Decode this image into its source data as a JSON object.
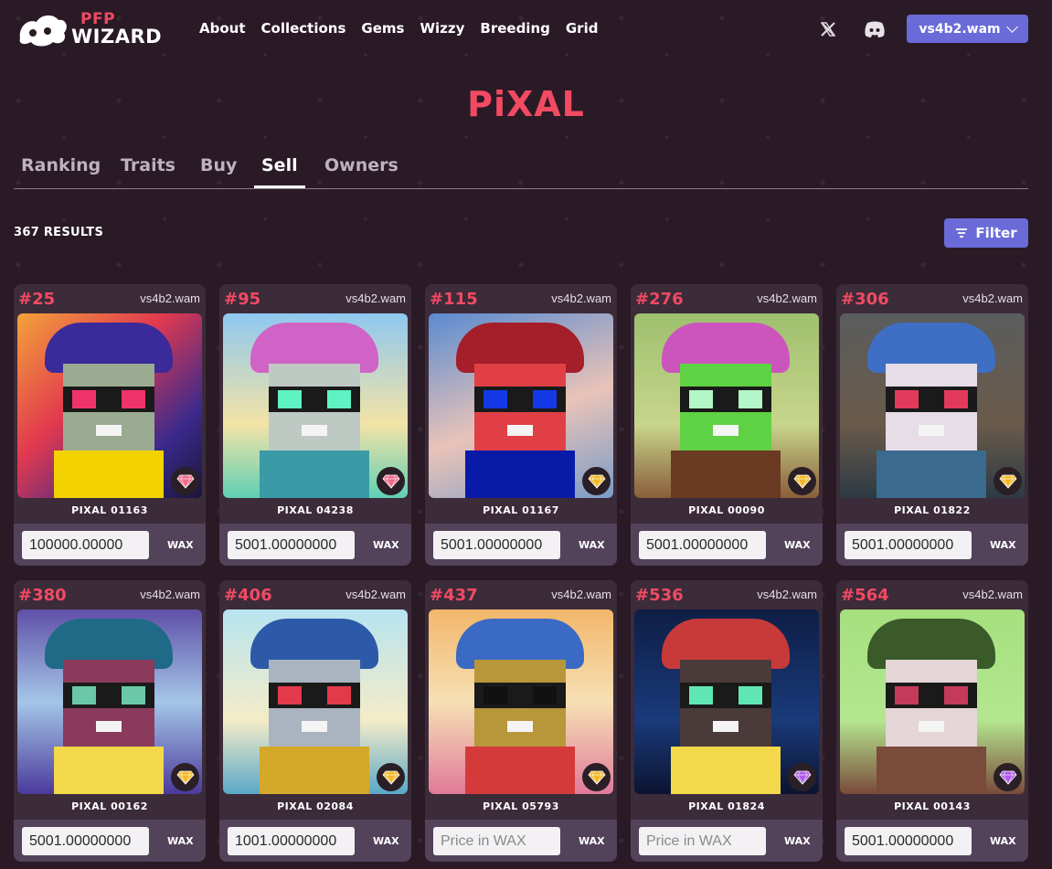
{
  "nav": {
    "logo_top": "PFP",
    "logo_bottom": "WIZARD",
    "links": [
      "About",
      "Collections",
      "Gems",
      "Wizzy",
      "Breeding",
      "Grid"
    ],
    "account": "vs4b2.wam"
  },
  "collection_title": "PiXAL",
  "tabs": [
    "Ranking",
    "Traits",
    "Buy",
    "Sell",
    "Owners"
  ],
  "active_tab": "Sell",
  "results_text": "367 RESULTS",
  "filter_label": "Filter",
  "price_placeholder": "Price in WAX",
  "currency": "WAX",
  "cards": [
    {
      "rank": "#25",
      "owner": "vs4b2.wam",
      "name": "PIXAL 01163",
      "price": "100000.00000",
      "gem": "pink"
    },
    {
      "rank": "#95",
      "owner": "vs4b2.wam",
      "name": "PIXAL 04238",
      "price": "5001.00000000",
      "gem": "pink"
    },
    {
      "rank": "#115",
      "owner": "vs4b2.wam",
      "name": "PIXAL 01167",
      "price": "5001.00000000",
      "gem": "gold"
    },
    {
      "rank": "#276",
      "owner": "vs4b2.wam",
      "name": "PIXAL 00090",
      "price": "5001.00000000",
      "gem": "gold"
    },
    {
      "rank": "#306",
      "owner": "vs4b2.wam",
      "name": "PIXAL 01822",
      "price": "5001.00000000",
      "gem": "gold"
    },
    {
      "rank": "#380",
      "owner": "vs4b2.wam",
      "name": "PIXAL 00162",
      "price": "5001.00000000",
      "gem": "gold"
    },
    {
      "rank": "#406",
      "owner": "vs4b2.wam",
      "name": "PIXAL 02084",
      "price": "1001.00000000",
      "gem": "gold"
    },
    {
      "rank": "#437",
      "owner": "vs4b2.wam",
      "name": "PIXAL 05793",
      "price": "",
      "gem": "gold"
    },
    {
      "rank": "#536",
      "owner": "vs4b2.wam",
      "name": "PIXAL 01824",
      "price": "",
      "gem": "purple"
    },
    {
      "rank": "#564",
      "owner": "vs4b2.wam",
      "name": "PIXAL 00143",
      "price": "5001.00000000",
      "gem": "purple"
    }
  ],
  "colors": {
    "accent": "#6a6bd8",
    "brand_red": "#f14a63",
    "card_bg": "#3c2b39",
    "page_bg": "#2a1a26"
  }
}
